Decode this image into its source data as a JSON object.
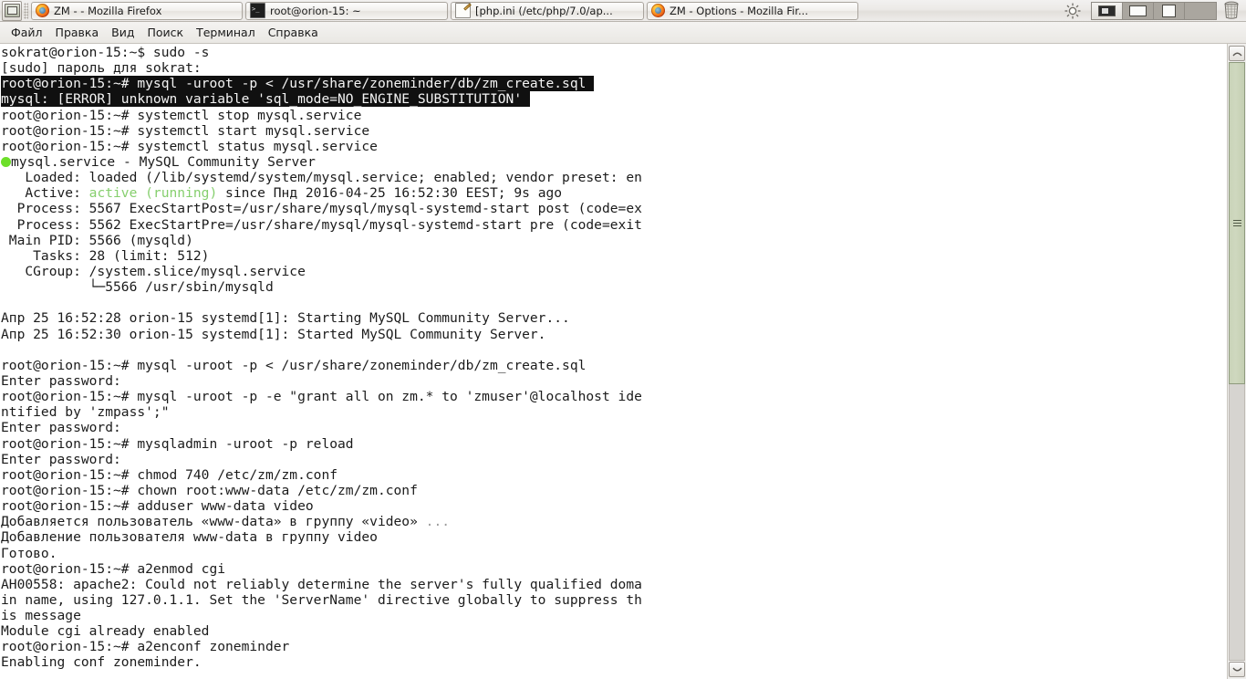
{
  "taskbar": {
    "show_desktop_tooltip": "Show Desktop",
    "tasks": [
      {
        "label": "ZM - - Mozilla Firefox",
        "icon": "firefox-icon",
        "active": false
      },
      {
        "label": "root@orion-15: ~",
        "icon": "terminal-icon",
        "active": true
      },
      {
        "label": "[php.ini (/etc/php/7.0/ap...",
        "icon": "text-editor-icon",
        "active": false
      },
      {
        "label": "ZM - Options - Mozilla Fir...",
        "icon": "firefox-icon",
        "active": false
      }
    ],
    "tray": {
      "brightness_icon": "sun-icon",
      "trash_icon": "trash-icon"
    },
    "pager": {
      "workspaces": [
        {
          "name": "workspace-1",
          "active": true
        },
        {
          "name": "workspace-2",
          "active": false
        },
        {
          "name": "workspace-3",
          "active": false
        },
        {
          "name": "workspace-4",
          "active": false
        }
      ]
    }
  },
  "menubar": {
    "items": [
      {
        "label": "Файл"
      },
      {
        "label": "Правка"
      },
      {
        "label": "Вид"
      },
      {
        "label": "Поиск"
      },
      {
        "label": "Терминал"
      },
      {
        "label": "Справка"
      }
    ]
  },
  "terminal": {
    "background": "#ffffff",
    "foreground": "#1b1b1b",
    "selection_background": "#101010",
    "selection_foreground": "#f4f4f4",
    "success_color": "#4fbf38",
    "lines": [
      "sokrat@orion-15:~$ sudo -s",
      "[sudo] пароль для sokrat:",
      "root@orion-15:~# mysql -uroot -p < /usr/share/zoneminder/db/zm_create.sql",
      "mysql: [ERROR] unknown variable 'sql_mode=NO_ENGINE_SUBSTITUTION'",
      "root@orion-15:~# systemctl stop mysql.service",
      "root@orion-15:~# systemctl start mysql.service",
      "root@orion-15:~# systemctl status mysql.service",
      "mysql.service - MySQL Community Server",
      "   Loaded: loaded (/lib/systemd/system/mysql.service; enabled; vendor preset: en",
      "   Active: active (running) since Пнд 2016-04-25 16:52:30 EEST; 9s ago",
      "  Process: 5567 ExecStartPost=/usr/share/mysql/mysql-systemd-start post (code=ex",
      "  Process: 5562 ExecStartPre=/usr/share/mysql/mysql-systemd-start pre (code=exit",
      " Main PID: 5566 (mysqld)",
      "    Tasks: 28 (limit: 512)",
      "   CGroup: /system.slice/mysql.service",
      "           └─5566 /usr/sbin/mysqld",
      "",
      "Апр 25 16:52:28 orion-15 systemd[1]: Starting MySQL Community Server...",
      "Апр 25 16:52:30 orion-15 systemd[1]: Started MySQL Community Server.",
      "",
      "root@orion-15:~# mysql -uroot -p < /usr/share/zoneminder/db/zm_create.sql",
      "Enter password:",
      "root@orion-15:~# mysql -uroot -p -e \"grant all on zm.* to 'zmuser'@localhost ide",
      "ntified by 'zmpass';\"",
      "Enter password:",
      "root@orion-15:~# mysqladmin -uroot -p reload",
      "Enter password:",
      "root@orion-15:~# chmod 740 /etc/zm/zm.conf",
      "root@orion-15:~# chown root:www-data /etc/zm/zm.conf",
      "root@orion-15:~# adduser www-data video",
      "Добавляется пользователь «www-data» в группу «video» ...",
      "Добавление пользователя www-data в группу video",
      "Готово.",
      "root@orion-15:~# a2enmod cgi",
      "AH00558: apache2: Could not reliably determine the server's fully qualified doma",
      "in name, using 127.0.1.1. Set the 'ServerName' directive globally to suppress th",
      "is message",
      "Module cgi already enabled",
      "root@orion-15:~# a2enconf zoneminder",
      "Enabling conf zoneminder."
    ],
    "segments": {
      "line_2_selected": "root@orion-15:~# mysql -uroot -p < /usr/share/zoneminder/db/zm_create.sql",
      "line_3_selected": "mysql: [ERROR] unknown variable 'sql_mode=NO_ENGINE_SUBSTITUTION'",
      "status_dot": "●",
      "status_title": "mysql.service - MySQL Community Server",
      "active_prefix": "   Active: ",
      "active_state": "active (running)",
      "active_suffix": " since Пнд 2016-04-25 16:52:30 EEST; 9s ago",
      "adduser_prefix": "Добавляется пользователь «www-data» в группу «video» ",
      "adduser_ellipsis": "..."
    }
  },
  "scrollbar": {
    "name": "terminal-scrollbar",
    "up_arrow": "scroll-up-icon",
    "down_arrow": "scroll-down-icon",
    "thumb_color": "#c9d3b8"
  }
}
